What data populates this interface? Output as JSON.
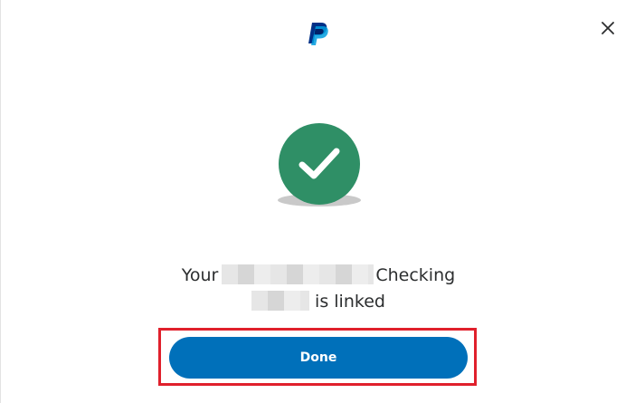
{
  "header": {
    "logo_icon": "paypal-logo",
    "close_icon": "close-icon"
  },
  "status": {
    "icon": "checkmark-icon",
    "color": "#2f8f66"
  },
  "message": {
    "prefix": "Your",
    "account_type": "Checking",
    "suffix": "is linked"
  },
  "actions": {
    "done_label": "Done",
    "done_color": "#0070ba",
    "highlight_color": "#e0202c"
  }
}
